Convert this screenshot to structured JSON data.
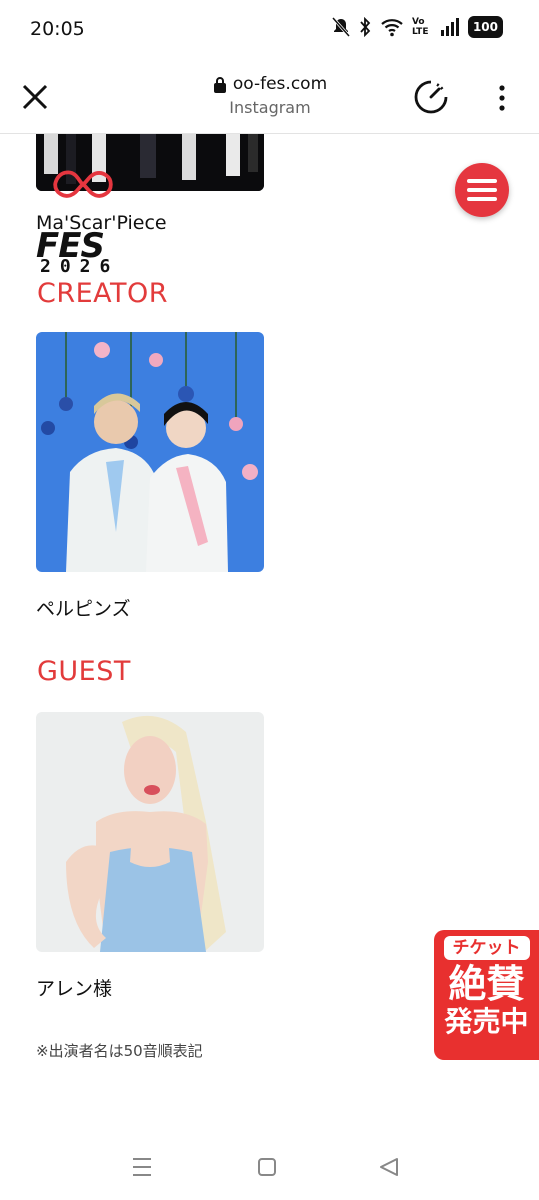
{
  "status_bar": {
    "time": "20:05",
    "battery": "100",
    "volte": "Vo LTE"
  },
  "browser": {
    "url": "oo-fes.com",
    "subtitle": "Instagram"
  },
  "logo": {
    "brand_text": "FES",
    "year_text": "2026"
  },
  "top_item": {
    "name": "Ma'Scar'Piece"
  },
  "sections": [
    {
      "title": "CREATOR",
      "items": [
        {
          "name": "ペルピンズ"
        }
      ]
    },
    {
      "title": "GUEST",
      "items": [
        {
          "name": "アレン様"
        }
      ]
    }
  ],
  "note": "※出演者名は50音順表記",
  "ticket_badge": {
    "top": "チケット",
    "middle": "絶賛",
    "bottom": "発売中"
  },
  "colors": {
    "accent_red": "#e23b3b",
    "menu_button": "#e5363f",
    "ticket_red": "#e8302f"
  },
  "icons": [
    "close-icon",
    "lock-icon",
    "speedometer-icon",
    "more-vert-icon",
    "hamburger-icon",
    "recents-icon",
    "home-icon",
    "back-icon"
  ]
}
